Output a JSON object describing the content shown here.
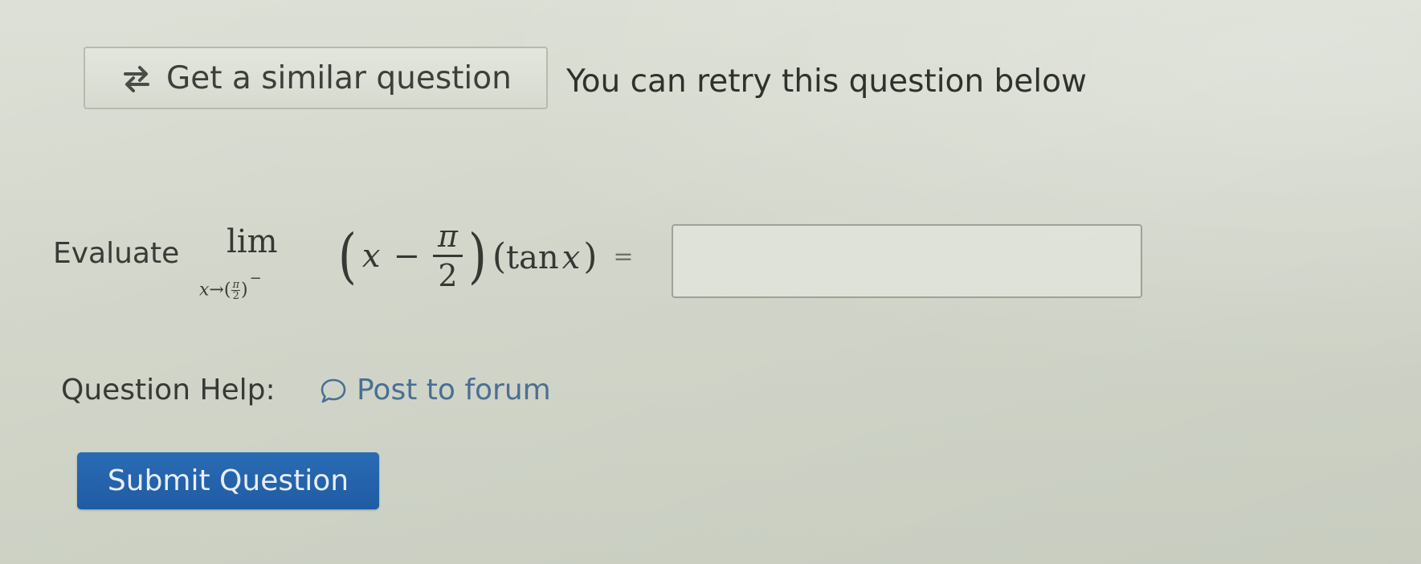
{
  "top_bar": {
    "similar_button_label": "Get a similar question",
    "retry_message": "You can retry this question below"
  },
  "question": {
    "prompt_label": "Evaluate",
    "math": {
      "lim": "lim",
      "limit_variable": "x",
      "arrow": "→",
      "limit_value_num": "π",
      "limit_value_den": "2",
      "one_sided": "−",
      "var": "x",
      "minus": "−",
      "frac_num": "π",
      "frac_den": "2",
      "tan": "tan",
      "equals": "="
    },
    "answer_value": ""
  },
  "help": {
    "label": "Question Help:",
    "forum_link": "Post to forum"
  },
  "submit": {
    "label": "Submit Question"
  },
  "icons": {
    "similar": "repeat-arrows-icon",
    "forum": "speech-bubble-icon"
  },
  "colors": {
    "background": "#d3d7cb",
    "link": "#4a6f93",
    "primary_button": "#2163ab"
  }
}
